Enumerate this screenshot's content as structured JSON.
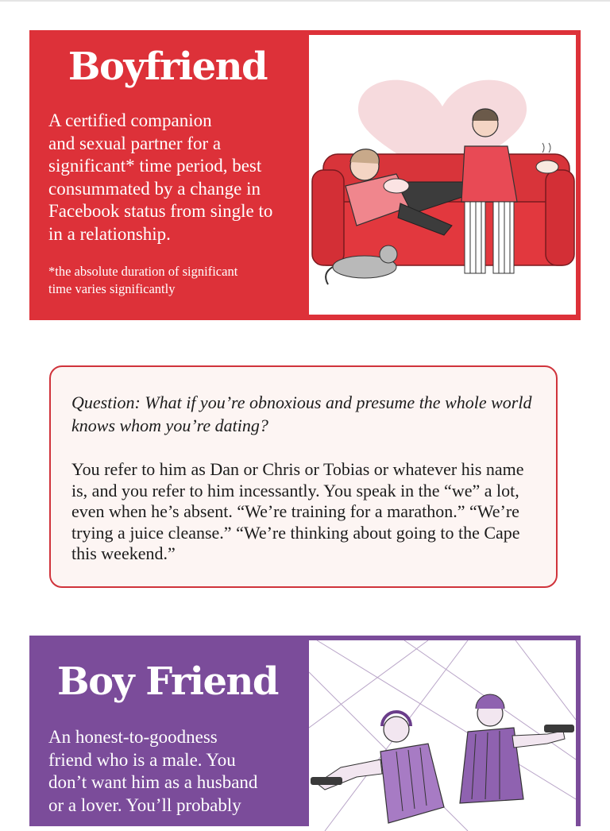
{
  "colors": {
    "boyfriend_card": "#dd3139",
    "boy_friend_card": "#7b4c9a",
    "qa_border": "#d0333b",
    "qa_background": "#fdf5f3"
  },
  "boyfriend": {
    "title": "Boyfriend",
    "definition": "A certified companion\nand sexual partner for a\nsignificant* time period, best\nconsummated by a change in\nFacebook status from single to\nin a relationship.",
    "footnote": "*the absolute duration of significant\ntime varies significantly",
    "illustration": "couple-on-red-couch-illustration"
  },
  "qa": {
    "question": "Question: What if you’re obnoxious and presume the whole world knows whom you’re dating?",
    "answer": "You refer to him as Dan or Chris or Tobias or whatever his name is, and you refer to him incessantly.  You speak in the “we” a lot, even when he’s absent.  “We’re training for a marathon.”  “We’re trying a juice cleanse.”  “We’re thinking about going to the Cape this weekend.”"
  },
  "boy_friend": {
    "title": "Boy Friend",
    "definition": "An honest-to-goodness\nfriend who is a male.  You\ndon’t want him as a husband\nor a lover.  You’ll probably",
    "illustration": "laser-tag-friends-illustration"
  }
}
